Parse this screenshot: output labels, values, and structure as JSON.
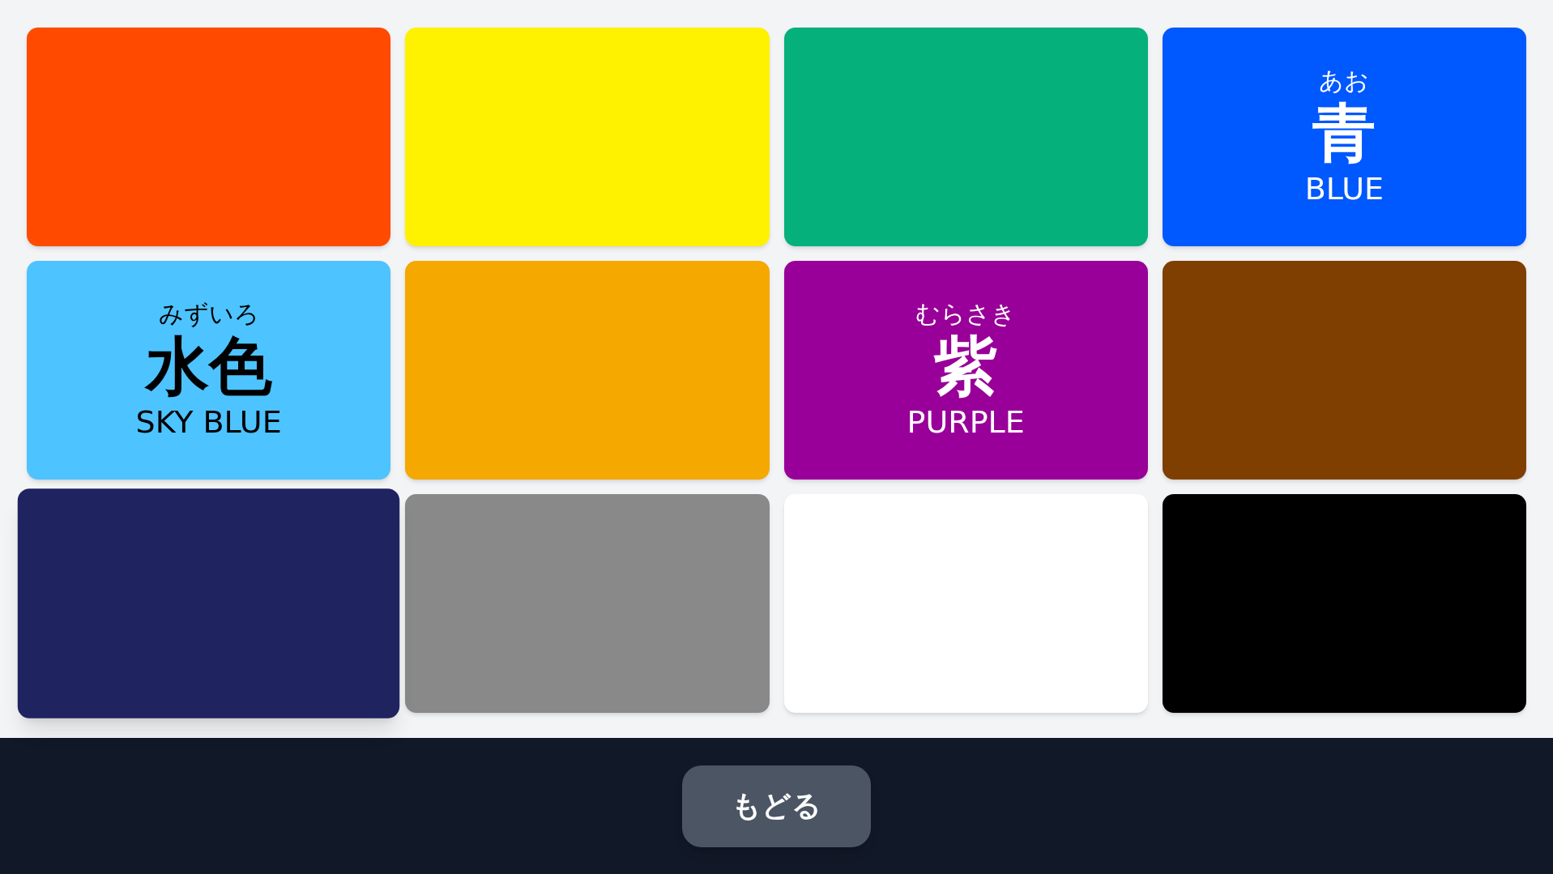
{
  "cards": [
    {
      "color": "#ff4a00",
      "selected": false
    },
    {
      "color": "#fff200",
      "selected": false
    },
    {
      "color": "#05b07b",
      "selected": false
    },
    {
      "color": "#0058ff",
      "selected": false,
      "reading": "あお",
      "kanji": "青",
      "english": "BLUE"
    },
    {
      "color": "#4dc3ff",
      "selected": false,
      "reading": "みずいろ",
      "kanji": "水色",
      "english": "SKY BLUE"
    },
    {
      "color": "#f5a800",
      "selected": false
    },
    {
      "color": "#990099",
      "selected": false,
      "reading": "むらさき",
      "kanji": "紫",
      "english": "PURPLE"
    },
    {
      "color": "#7f3f00",
      "selected": false
    },
    {
      "color": "#1f2360",
      "selected": true
    },
    {
      "color": "#898989",
      "selected": false
    },
    {
      "color": "#ffffff",
      "selected": false
    },
    {
      "color": "#000000",
      "selected": false
    }
  ],
  "back_button": {
    "label": "もどる"
  }
}
